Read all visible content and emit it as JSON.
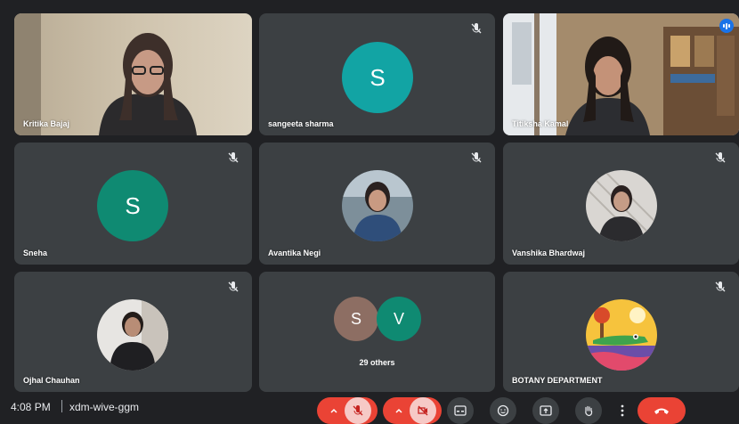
{
  "participants": [
    {
      "name": "Kritika Bajaj",
      "type": "video",
      "muted": false
    },
    {
      "name": "sangeeta sharma",
      "type": "initial",
      "initial": "S",
      "color": "#12a4a4",
      "muted": true
    },
    {
      "name": "Titiksha Kamal",
      "type": "video",
      "muted": false,
      "speaking": true
    },
    {
      "name": "Sneha",
      "type": "initial",
      "initial": "S",
      "color": "#0f8a72",
      "muted": true
    },
    {
      "name": "Avantika Negi",
      "type": "photo",
      "muted": true
    },
    {
      "name": "Vanshika Bhardwaj",
      "type": "photo",
      "muted": true
    },
    {
      "name": "Ojhal Chauhan",
      "type": "photo",
      "muted": true
    },
    {
      "name": "others",
      "type": "group",
      "initials": [
        "S",
        "V"
      ],
      "colors": [
        "#8d6e63",
        "#0f8a72"
      ],
      "label": "29 others"
    },
    {
      "name": "BOTANY DEPARTMENT",
      "type": "logo",
      "muted": true
    }
  ],
  "bottom_bar": {
    "time": "4:08 PM",
    "meeting_code": "xdm-wive-ggm",
    "controls": [
      {
        "name": "mic-options",
        "icon": "chevron-up-icon"
      },
      {
        "name": "microphone",
        "icon": "mic-off-icon",
        "state": "off"
      },
      {
        "name": "camera-options",
        "icon": "chevron-up-icon"
      },
      {
        "name": "camera",
        "icon": "camera-off-icon",
        "state": "off"
      },
      {
        "name": "captions",
        "icon": "captions-icon"
      },
      {
        "name": "reactions",
        "icon": "emoji-icon"
      },
      {
        "name": "present",
        "icon": "present-icon"
      },
      {
        "name": "raise-hand",
        "icon": "hand-icon"
      },
      {
        "name": "more-options",
        "icon": "more-vert-icon"
      },
      {
        "name": "leave-call",
        "icon": "phone-hangup-icon"
      }
    ]
  },
  "colors": {
    "background": "#202124",
    "tile": "#3c4043",
    "danger": "#ea4335",
    "speaking_outline": "#8ab4f8"
  }
}
